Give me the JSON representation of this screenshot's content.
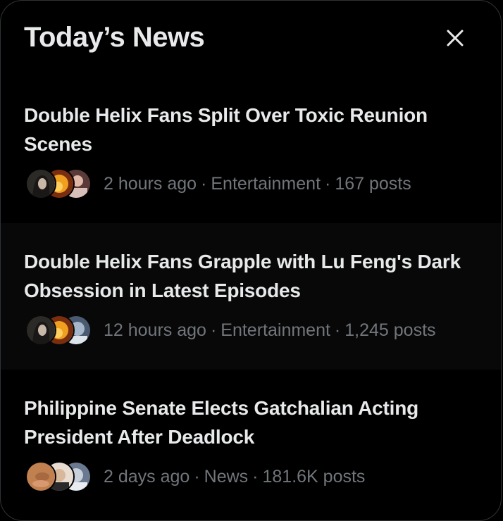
{
  "header": {
    "title": "Today’s News",
    "close_icon": "close-icon"
  },
  "items": [
    {
      "title": "Double Helix Fans Split Over Toxic Reunion Scenes",
      "time": "2 hours ago",
      "category": "Entertainment",
      "posts": "167 posts",
      "avatar_colors": [
        "#3a3530",
        "#e8a020",
        "#b89080"
      ]
    },
    {
      "title": "Double Helix Fans Grapple with Lu Feng's Dark Obsession in Latest Episodes",
      "time": "12 hours ago",
      "category": "Entertainment",
      "posts": "1,245 posts",
      "avatar_colors": [
        "#3a3530",
        "#e8a020",
        "#8aa0b8"
      ]
    },
    {
      "title": "Philippine Senate Elects Gatchalian Acting President After Deadlock",
      "time": "2 days ago",
      "category": "News",
      "posts": "181.6K posts",
      "avatar_colors": [
        "#c08050",
        "#e0c8b0",
        "#9aa8c0"
      ]
    }
  ],
  "colors": {
    "background": "#000000",
    "text_primary": "#e7e9ea",
    "text_secondary": "#71767b",
    "hover_background": "#080808"
  }
}
